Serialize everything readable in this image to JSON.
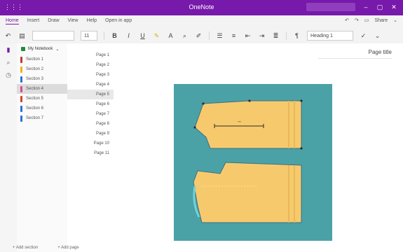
{
  "app": {
    "title": "OneNote",
    "colors": {
      "titlebar": "#7719aa",
      "accent": "#7719aa",
      "figure_bg": "#4aa2a7",
      "pattern_fill": "#f7c96d",
      "pattern_stroke": "#3a6f86"
    }
  },
  "menu": {
    "items": [
      "Home",
      "Insert",
      "Draw",
      "View",
      "Help",
      "Open in app"
    ],
    "right": [
      "Share"
    ]
  },
  "ribbon": {
    "font_size": "11",
    "style": "Heading 1"
  },
  "notebook": {
    "name": "My Notebook"
  },
  "sections": [
    {
      "label": "Section 1",
      "color": "#c0392b"
    },
    {
      "label": "Section 2",
      "color": "#f2b01e"
    },
    {
      "label": "Section 3",
      "color": "#2e6fd8"
    },
    {
      "label": "Section 4",
      "color": "#d44d8c",
      "selected": true
    },
    {
      "label": "Section 5",
      "color": "#d6402e"
    },
    {
      "label": "Section 6",
      "color": "#2e6fd8"
    },
    {
      "label": "Section 7",
      "color": "#2e6fd8"
    }
  ],
  "pages": [
    {
      "label": "Page 1"
    },
    {
      "label": "Page 2"
    },
    {
      "label": "Page 3"
    },
    {
      "label": "Page 4"
    },
    {
      "label": "Page 5",
      "selected": true
    },
    {
      "label": "Page 6"
    },
    {
      "label": "Page 7"
    },
    {
      "label": "Page 8"
    },
    {
      "label": "Page 9"
    },
    {
      "label": "Page 10"
    },
    {
      "label": "Page 11"
    }
  ],
  "footer": {
    "add_section": "+ Add section",
    "add_page": "+ Add page"
  },
  "page": {
    "title": "Page title"
  },
  "figure": {
    "dimension_label": "↔"
  }
}
